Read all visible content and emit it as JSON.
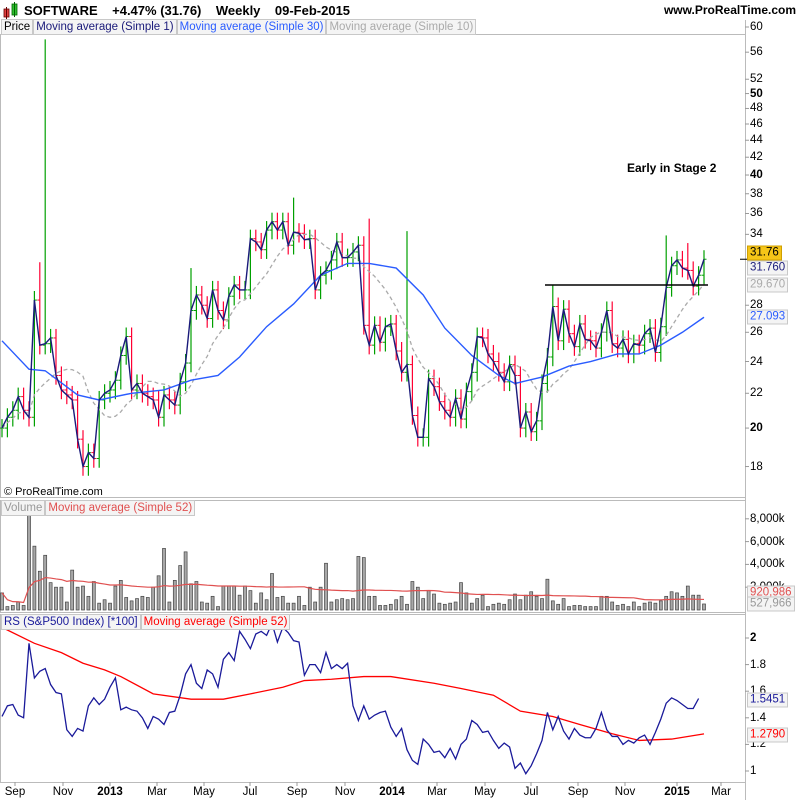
{
  "header": {
    "symbol": "SOFTWARE",
    "change": "+4.47% (31.76)",
    "period": "Weekly",
    "date": "09-Feb-2015",
    "site": "www.ProRealTime.com"
  },
  "price_legend": {
    "price": "Price",
    "ma1": "Moving average (Simple 1)",
    "ma30": "Moving average (Simple 30)",
    "ma10": "Moving average (Simple 10)"
  },
  "volume_legend": {
    "volume": "Volume",
    "ma52": "Moving average (Simple 52)"
  },
  "rs_legend": {
    "rs": "RS (S&P500 Index) [*100]",
    "ma52": "Moving average (Simple 52)"
  },
  "copyright": "© ProRealTime.com",
  "annotation": "Early in Stage 2",
  "value_boxes": {
    "last": "31.76",
    "ma1": "31.760",
    "ma10": "29.670",
    "ma30": "27.093",
    "vol_ma": "920,986",
    "vol": "527,966",
    "rs": "1.5451",
    "rs_ma": "1.2790"
  },
  "colors": {
    "up": "#00a000",
    "down": "#ff0033",
    "ma1": "#1a1a7a",
    "ma30": "#2a5cff",
    "ma10": "#aaaaaa",
    "rs": "#1a1a9a",
    "rs_ma": "#ff0000",
    "vol_ma": "#e05050",
    "last_box": "#f5c518"
  },
  "chart_data": [
    {
      "type": "line",
      "title": "Price (weekly OHLC bars, log scale)",
      "ylim": [
        16,
        60
      ],
      "yticks": [
        {
          "v": 60,
          "l": "60"
        },
        {
          "v": 56,
          "l": "56"
        },
        {
          "v": 52,
          "l": "52"
        },
        {
          "v": 50,
          "l": "50",
          "b": true
        },
        {
          "v": 48,
          "l": "48"
        },
        {
          "v": 46,
          "l": "46"
        },
        {
          "v": 44,
          "l": "44"
        },
        {
          "v": 42,
          "l": "42"
        },
        {
          "v": 40,
          "l": "40",
          "b": true
        },
        {
          "v": 38,
          "l": "38"
        },
        {
          "v": 36,
          "l": "36"
        },
        {
          "v": 34,
          "l": "34"
        },
        {
          "v": 28,
          "l": "28"
        },
        {
          "v": 26,
          "l": "26"
        },
        {
          "v": 24,
          "l": "24"
        },
        {
          "v": 22,
          "l": "22"
        },
        {
          "v": 20,
          "l": "20",
          "b": true
        },
        {
          "v": 18,
          "l": "18"
        }
      ],
      "close": [
        20.0,
        20.6,
        21.0,
        21.8,
        21.0,
        20.6,
        28.4,
        25.1,
        25.2,
        25.6,
        23.1,
        22.2,
        21.9,
        21.6,
        19.4,
        18.0,
        18.7,
        18.4,
        21.6,
        22.0,
        22.2,
        22.8,
        24.4,
        25.7,
        22.2,
        22.6,
        22.0,
        21.8,
        21.6,
        20.6,
        21.9,
        21.6,
        21.3,
        22.7,
        23.9,
        27.6,
        28.8,
        28.0,
        27.0,
        29.2,
        27.6,
        26.9,
        28.7,
        29.6,
        29.2,
        29.2,
        33.6,
        33.3,
        32.6,
        34.4,
        35.2,
        34.4,
        35.2,
        33.0,
        34.2,
        34.1,
        33.5,
        33.6,
        29.2,
        30.4,
        30.8,
        31.7,
        33.3,
        31.9,
        31.9,
        32.4,
        33.0,
        26.5,
        25.1,
        26.5,
        25.3,
        26.4,
        26.6,
        24.7,
        23.3,
        23.8,
        20.7,
        19.5,
        19.5,
        22.9,
        22.4,
        21.5,
        21.0,
        20.6,
        21.7,
        20.5,
        22.1,
        23.3,
        25.7,
        25.6,
        24.5,
        24.0,
        23.3,
        22.7,
        23.8,
        23.1,
        20.0,
        20.9,
        19.8,
        20.4,
        22.6,
        24.3,
        27.9,
        25.4,
        27.7,
        25.9,
        25.0,
        26.6,
        25.5,
        25.4,
        24.9,
        26.0,
        27.6,
        25.2,
        24.9,
        25.5,
        24.5,
        25.2,
        25.1,
        25.9,
        26.3,
        24.6,
        26.4,
        29.4,
        31.2,
        31.7,
        31.0,
        30.8,
        29.5,
        30.4,
        31.76
      ],
      "high_overrides": {
        "8": 58.0,
        "7": 31.5,
        "35": 31.0,
        "54": 37.6,
        "68": 35.5,
        "75": 34.3,
        "102": 29.6,
        "123": 33.9,
        "127": 33.2
      },
      "ma30": [
        [
          0,
          25.4
        ],
        [
          5,
          23.5
        ],
        [
          8,
          23.4
        ],
        [
          14,
          21.9
        ],
        [
          18,
          21.6
        ],
        [
          24,
          22.0
        ],
        [
          30,
          22.2
        ],
        [
          35,
          22.8
        ],
        [
          40,
          23.1
        ],
        [
          44,
          24.3
        ],
        [
          49,
          26.4
        ],
        [
          54,
          28.1
        ],
        [
          59,
          30.4
        ],
        [
          64,
          31.4
        ],
        [
          68,
          31.4
        ],
        [
          73,
          31.0
        ],
        [
          78,
          28.8
        ],
        [
          82,
          26.3
        ],
        [
          87,
          24.4
        ],
        [
          92,
          23.1
        ],
        [
          95,
          22.6
        ],
        [
          100,
          23.0
        ],
        [
          105,
          23.7
        ],
        [
          109,
          24.0
        ],
        [
          114,
          24.5
        ],
        [
          118,
          24.5
        ],
        [
          122,
          25.1
        ],
        [
          126,
          26.0
        ],
        [
          130,
          27.093
        ]
      ],
      "stage2_level": 29.6,
      "xlabels": [
        {
          "l": "Sep"
        },
        {
          "l": "Nov"
        },
        {
          "l": "2013",
          "b": true
        },
        {
          "l": "Mar"
        },
        {
          "l": "May"
        },
        {
          "l": "Jul"
        },
        {
          "l": "Sep"
        },
        {
          "l": "Nov"
        },
        {
          "l": "2014",
          "b": true
        },
        {
          "l": "Mar"
        },
        {
          "l": "May"
        },
        {
          "l": "Jul"
        },
        {
          "l": "Sep"
        },
        {
          "l": "Nov"
        },
        {
          "l": "2015",
          "b": true
        },
        {
          "l": "Mar"
        }
      ]
    },
    {
      "type": "bar",
      "title": "Volume (millions)",
      "ylim": [
        0,
        9
      ],
      "yticks": [
        {
          "v": 8,
          "l": "8,000k"
        },
        {
          "v": 6,
          "l": "6,000k"
        },
        {
          "v": 4,
          "l": "4,000k"
        },
        {
          "v": 2,
          "l": "2,000k"
        }
      ],
      "values": [
        1.5,
        0.3,
        0.4,
        0.7,
        0.4,
        8.5,
        5.6,
        3.4,
        4.8,
        2.4,
        2.0,
        2.0,
        0.7,
        3.5,
        2.0,
        2.1,
        1.2,
        2.5,
        0.6,
        0.9,
        0.6,
        2.1,
        2.6,
        1.1,
        0.8,
        1.0,
        1.2,
        1.1,
        2.0,
        3.0,
        5.4,
        0.7,
        2.6,
        3.9,
        5.1,
        2.3,
        2.5,
        0.7,
        0.6,
        1.2,
        0.3,
        2.1,
        2.1,
        2.1,
        1.3,
        2.1,
        1.7,
        0.6,
        1.5,
        0.9,
        3.2,
        1.1,
        1.2,
        0.6,
        0.6,
        1.2,
        0.4,
        2.0,
        0.7,
        2.0,
        4.1,
        0.7,
        0.9,
        1.0,
        0.9,
        1.0,
        4.7,
        4.6,
        1.2,
        1.2,
        0.4,
        0.4,
        0.5,
        0.9,
        1.2,
        0.5,
        2.5,
        2.0,
        1.0,
        1.7,
        1.4,
        0.6,
        0.5,
        0.6,
        0.7,
        2.4,
        1.5,
        0.6,
        1.0,
        1.3,
        0.3,
        0.5,
        0.6,
        0.5,
        0.9,
        1.4,
        0.9,
        1.3,
        1.6,
        1.2,
        1.0,
        2.7,
        0.8,
        0.5,
        1.0,
        0.3,
        0.4,
        0.4,
        0.3,
        0.3,
        0.3,
        1.2,
        1.2,
        0.7,
        0.4,
        0.5,
        0.3,
        0.7,
        0.3,
        0.6,
        0.7,
        0.6,
        0.8,
        1.2,
        1.6,
        1.5,
        1.2,
        2.1,
        1.3,
        1.3,
        0.528
      ]
    },
    {
      "type": "line",
      "title": "RS (S&P500 Index) [*100]",
      "ylim": [
        0.95,
        2.15
      ],
      "yticks": [
        {
          "v": 2,
          "l": "2",
          "b": true
        },
        {
          "v": 1.8,
          "l": "1.8"
        },
        {
          "v": 1.6,
          "l": "1.6"
        },
        {
          "v": 1.4,
          "l": "1.4"
        },
        {
          "v": 1.2,
          "l": "1.2"
        },
        {
          "v": 1,
          "l": "1"
        }
      ],
      "rs": [
        1.41,
        1.49,
        1.5,
        1.42,
        1.4,
        1.96,
        1.7,
        1.75,
        1.77,
        1.65,
        1.59,
        1.58,
        1.31,
        1.26,
        1.32,
        1.3,
        1.49,
        1.55,
        1.5,
        1.54,
        1.63,
        1.7,
        1.46,
        1.48,
        1.46,
        1.45,
        1.4,
        1.32,
        1.41,
        1.39,
        1.35,
        1.44,
        1.45,
        1.57,
        1.73,
        1.8,
        1.66,
        1.62,
        1.76,
        1.73,
        1.63,
        1.84,
        1.89,
        1.83,
        2.05,
        1.99,
        1.92,
        2.03,
        2.05,
        2.02,
        2.11,
        1.97,
        2.08,
        2.04,
        1.98,
        1.97,
        1.72,
        1.8,
        1.8,
        1.74,
        1.89,
        1.77,
        1.8,
        1.77,
        1.81,
        1.49,
        1.38,
        1.49,
        1.39,
        1.42,
        1.44,
        1.45,
        1.33,
        1.26,
        1.32,
        1.16,
        1.08,
        1.05,
        1.24,
        1.2,
        1.14,
        1.15,
        1.1,
        1.17,
        1.09,
        1.2,
        1.24,
        1.38,
        1.35,
        1.29,
        1.3,
        1.23,
        1.17,
        1.21,
        1.18,
        1.02,
        1.06,
        0.98,
        1.04,
        1.13,
        1.23,
        1.44,
        1.31,
        1.41,
        1.3,
        1.24,
        1.32,
        1.27,
        1.25,
        1.25,
        1.32,
        1.44,
        1.31,
        1.26,
        1.26,
        1.2,
        1.23,
        1.21,
        1.25,
        1.27,
        1.2,
        1.29,
        1.39,
        1.51,
        1.55,
        1.53,
        1.5,
        1.47,
        1.47,
        1.5451
      ],
      "ma52": [
        [
          0,
          2.08
        ],
        [
          6,
          1.96
        ],
        [
          11,
          1.89
        ],
        [
          15,
          1.81
        ],
        [
          19,
          1.76
        ],
        [
          22,
          1.71
        ],
        [
          28,
          1.58
        ],
        [
          35,
          1.54
        ],
        [
          41,
          1.54
        ],
        [
          46,
          1.58
        ],
        [
          52,
          1.63
        ],
        [
          56,
          1.68
        ],
        [
          61,
          1.69
        ],
        [
          67,
          1.71
        ],
        [
          72,
          1.71
        ],
        [
          80,
          1.66
        ],
        [
          85,
          1.62
        ],
        [
          91,
          1.57
        ],
        [
          96,
          1.45
        ],
        [
          102,
          1.41
        ],
        [
          107,
          1.35
        ],
        [
          113,
          1.28
        ],
        [
          118,
          1.23
        ],
        [
          124,
          1.24
        ],
        [
          130,
          1.279
        ]
      ]
    }
  ]
}
